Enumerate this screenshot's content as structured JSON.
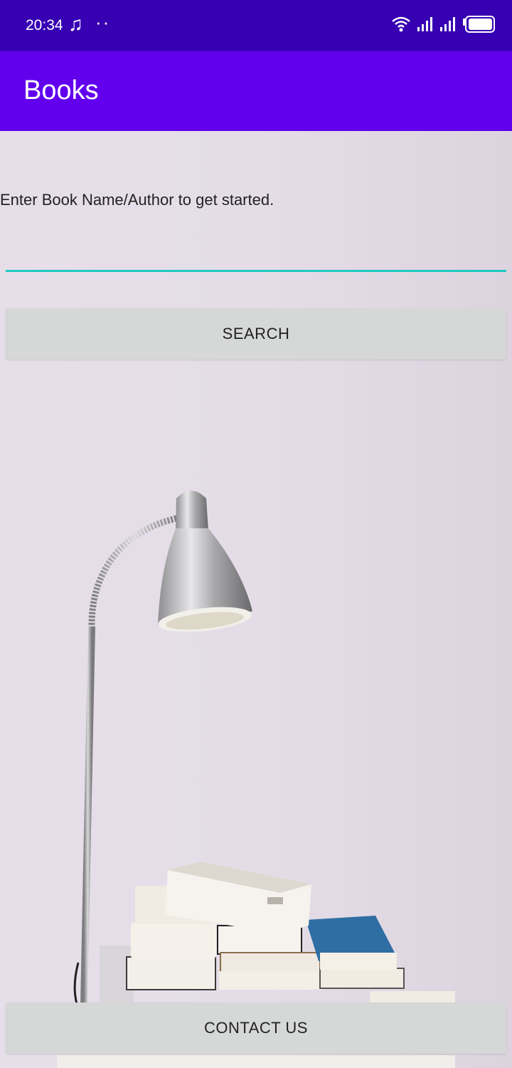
{
  "status_bar": {
    "time": "20:34",
    "music_icon": "♫",
    "dots": "··",
    "icons": [
      "wifi-icon",
      "signal-icon",
      "signal-icon",
      "battery-icon"
    ]
  },
  "app_bar": {
    "title": "Books"
  },
  "main": {
    "prompt": "Enter Book Name/Author to get started.",
    "search_value": "",
    "search_button_label": "SEARCH",
    "contact_button_label": "CONTACT US"
  },
  "background": {
    "subject": "floor lamp and stack of books"
  },
  "colors": {
    "status_bar": "#3700b3",
    "app_bar": "#6200ee",
    "input_underline": "#1fc8c4",
    "button": "#d6d7d7",
    "page_background": "#e3dce6"
  }
}
